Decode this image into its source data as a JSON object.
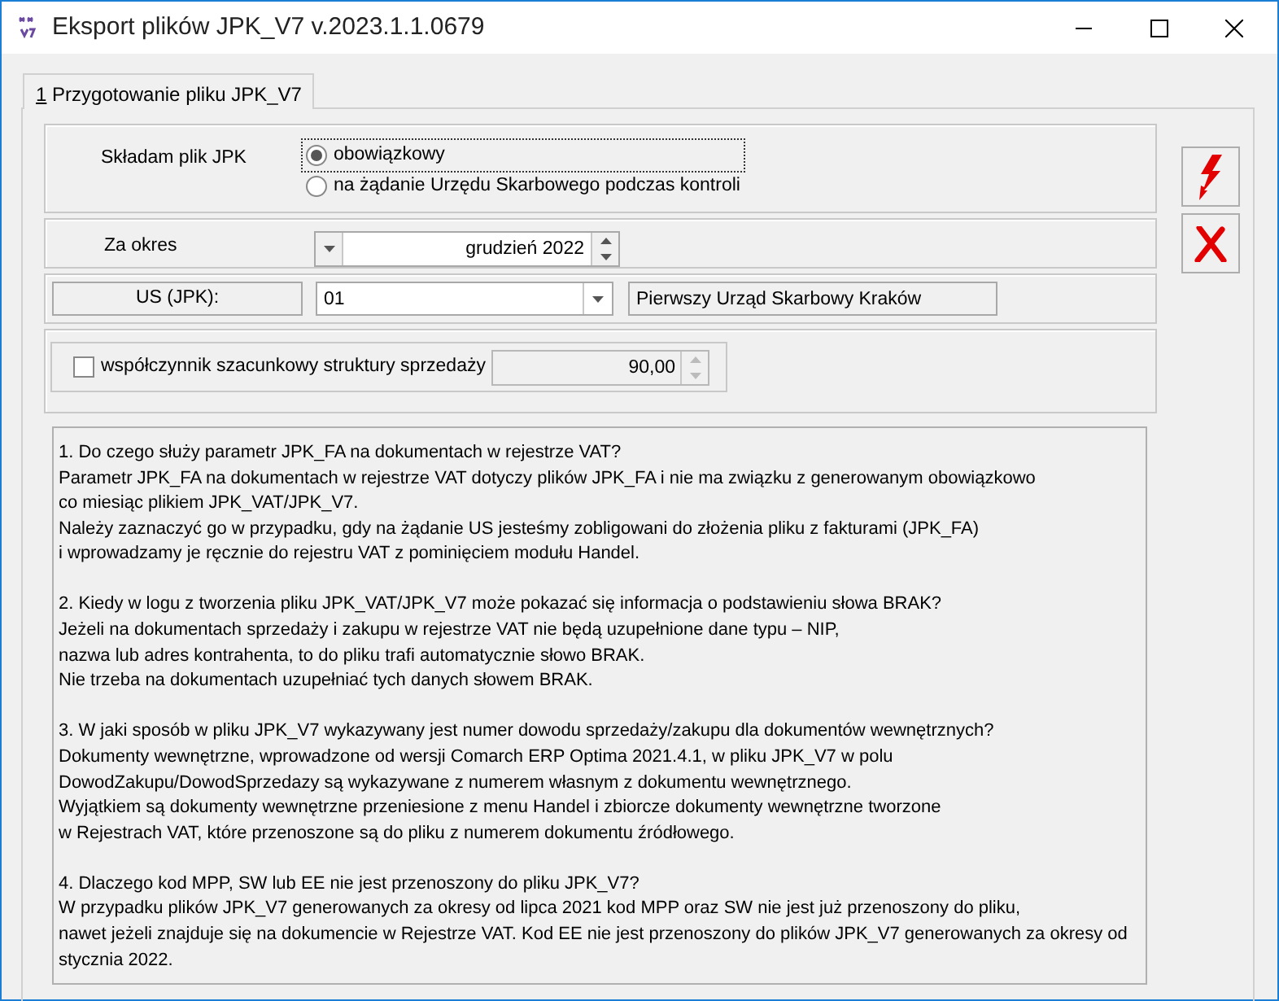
{
  "window": {
    "title": "Eksport plików JPK_V7 v.2023.1.1.0679"
  },
  "tabs": [
    {
      "hotkey": "1",
      "label": "Przygotowanie pliku JPK_V7",
      "selected": true
    }
  ],
  "filing": {
    "label": "Składam plik JPK",
    "options": [
      {
        "label": "obowiązkowy",
        "selected": true
      },
      {
        "label": "na żądanie Urzędu Skarbowego podczas kontroli",
        "selected": false
      }
    ]
  },
  "period": {
    "label": "Za okres",
    "value": "grudzień 2022"
  },
  "tax_office": {
    "label": "US (JPK):",
    "code": "01",
    "name": "Pierwszy Urząd Skarbowy Kraków"
  },
  "coefficient": {
    "label": "współczynnik szacunkowy struktury sprzedaży",
    "checked": false,
    "value": "90,00",
    "disabled": true
  },
  "info_text": {
    "paragraphs": [
      [
        "1. Do czego służy parametr JPK_FA na dokumentach w rejestrze VAT?",
        "Parametr JPK_FA na dokumentach w rejestrze VAT dotyczy plików JPK_FA i nie ma związku z generowanym obowiązkowo",
        "co miesiąc plikiem JPK_VAT/JPK_V7.",
        "Należy zaznaczyć go w przypadku, gdy na żądanie US jesteśmy zobligowani do złożenia pliku z fakturami (JPK_FA)",
        "i wprowadzamy je ręcznie do rejestru VAT z pominięciem modułu Handel."
      ],
      [
        "2. Kiedy w logu z tworzenia pliku JPK_VAT/JPK_V7 może pokazać się informacja o podstawieniu słowa BRAK?",
        "Jeżeli na dokumentach sprzedaży i zakupu w rejestrze VAT nie będą uzupełnione dane typu – NIP,",
        "nazwa lub adres kontrahenta, to do pliku trafi automatycznie słowo BRAK.",
        "Nie trzeba na dokumentach uzupełniać tych danych słowem BRAK."
      ],
      [
        "3. W jaki sposób w pliku JPK_V7 wykazywany jest numer dowodu sprzedaży/zakupu dla dokumentów wewnętrznych?",
        "Dokumenty wewnętrzne, wprowadzone od wersji Comarch ERP Optima 2021.4.1, w pliku JPK_V7 w polu",
        "DowodZakupu/DowodSprzedazy są wykazywane z numerem własnym z dokumentu wewnętrznego.",
        "Wyjątkiem są dokumenty wewnętrzne przeniesione z menu Handel i zbiorcze dokumenty wewnętrzne tworzone",
        "w Rejestrach VAT, które przenoszone są do pliku z numerem dokumentu źródłowego."
      ],
      [
        "4. Dlaczego kod MPP, SW lub EE nie jest przenoszony do pliku JPK_V7?",
        "W przypadku plików JPK_V7 generowanych za okresy od lipca 2021 kod MPP oraz SW nie jest już przenoszony do pliku,",
        "nawet jeżeli znajduje się na dokumencie w Rejestrze VAT. Kod EE nie jest przenoszony do plików JPK_V7 generowanych za okresy od",
        "stycznia 2022."
      ]
    ]
  },
  "actions": [
    {
      "kind": "export"
    },
    {
      "kind": "close"
    }
  ]
}
